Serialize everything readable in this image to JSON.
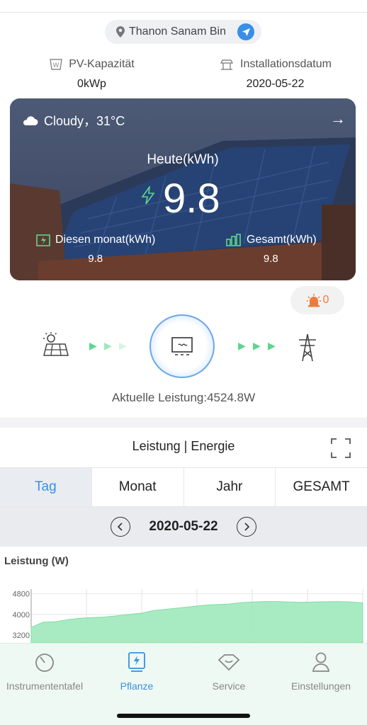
{
  "location": {
    "name": "Thanon Sanam Bin"
  },
  "info": {
    "capacity_label": "PV-Kapazität",
    "capacity_value": "0kWp",
    "install_label": "Installationsdatum",
    "install_value": "2020-05-22"
  },
  "hero": {
    "weather": "Cloudy，31°C",
    "today_label": "Heute(kWh)",
    "today_value": "9.8",
    "month_label": "Diesen monat(kWh)",
    "month_value": "9.8",
    "total_label": "Gesamt(kWh)",
    "total_value": "9.8"
  },
  "alarm": {
    "count": "0"
  },
  "flow": {
    "current_power": "Aktuelle Leistung:4524.8W"
  },
  "section": {
    "title": "Leistung | Energie"
  },
  "tabs": [
    {
      "label": "Tag",
      "active": true
    },
    {
      "label": "Monat",
      "active": false
    },
    {
      "label": "Jahr",
      "active": false
    },
    {
      "label": "GESAMT",
      "active": false
    }
  ],
  "date_nav": {
    "date": "2020-05-22"
  },
  "chart_data": {
    "type": "area",
    "ylabel": "Leistung (W)",
    "y_ticks": [
      "4800",
      "4000",
      "3200"
    ],
    "ylim": [
      2900,
      5200
    ],
    "grid": true,
    "series": [
      {
        "values": [
          3500,
          3700,
          3720,
          3800,
          3850,
          3880,
          3900,
          3950,
          4000,
          4050,
          4150,
          4200,
          4250,
          4300,
          4350,
          4380,
          4400,
          4450,
          4480,
          4500,
          4500,
          4480,
          4470,
          4480,
          4490,
          4500,
          4480,
          4450
        ]
      }
    ],
    "colors": {
      "fill": "#9ee9bd",
      "stroke": "#7fdca6"
    }
  },
  "nav": [
    {
      "label": "Instrumententafel",
      "icon": "dashboard-icon",
      "active": false
    },
    {
      "label": "Pflanze",
      "icon": "plant-icon",
      "active": true
    },
    {
      "label": "Service",
      "icon": "service-icon",
      "active": false
    },
    {
      "label": "Einstellungen",
      "icon": "user-icon",
      "active": false
    }
  ],
  "colors": {
    "accent": "#3a8ee6",
    "alarm": "#f07a3a",
    "flow": "#5ed58e"
  }
}
